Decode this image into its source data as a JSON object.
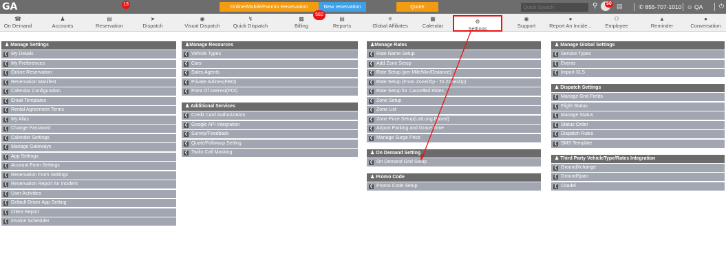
{
  "app": {
    "logo": "GA"
  },
  "topbar": {
    "buttons": [
      {
        "label": "Online/Mobile/Farmin Reservation",
        "color": "#f39c12"
      },
      {
        "label": "New reservation",
        "color": "#3fa0e8"
      },
      {
        "label": "Quote",
        "color": "#f39c12"
      }
    ],
    "search_placeholder": "Quick Search",
    "notifications_count": "50",
    "phone": "855-707-1010",
    "user": "QA"
  },
  "nav": {
    "items": [
      {
        "label": "On Demand",
        "icon": "phone-icon"
      },
      {
        "label": "Accounts",
        "icon": "user-icon"
      },
      {
        "label": "Reservation",
        "icon": "reservation-icon",
        "badge": "13"
      },
      {
        "label": "Dispatch",
        "icon": "send-icon"
      },
      {
        "label": "Visual Dispatch",
        "icon": "eye-icon"
      },
      {
        "label": "Quick Dispatch",
        "icon": "lightning-icon"
      },
      {
        "label": "Billing",
        "icon": "money-icon"
      },
      {
        "label": "Reports",
        "icon": "file-icon"
      },
      {
        "label": "Global Affiliates",
        "icon": "network-icon"
      },
      {
        "label": "Calendar",
        "icon": "calendar-icon"
      },
      {
        "label": "Settings",
        "icon": "gear-icon",
        "active": true
      },
      {
        "label": "Support",
        "icon": "support-icon"
      },
      {
        "label": "Report An Incide...",
        "icon": "alert-icon"
      },
      {
        "label": "Employee",
        "icon": "employee-icon"
      },
      {
        "label": "Reminder",
        "icon": "bell-icon"
      },
      {
        "label": "Conversation",
        "icon": "chat-icon"
      }
    ],
    "dispatch_badge": "582"
  },
  "sections": {
    "manage_settings": {
      "title": "Manage Settings",
      "items": [
        "My Details",
        "My Preferences",
        "Online Reservation",
        "Reservation Manifest",
        "Calendar Configuration",
        "Email Templates",
        "Rental Agreement Terms",
        "My Alias",
        "Change Password",
        "Calender Settings",
        "Manage Gateways",
        "App Settings",
        "Account Form Settings",
        "Reservation Form Settings",
        "Reservation Report An Incident",
        "User Activities",
        "Default Driver App Setting",
        "Client Report",
        "Invoice Scheduler"
      ]
    },
    "manage_resources": {
      "title": "Manage Resources",
      "items": [
        "Vehicle Types",
        "Cars",
        "Sales Agents",
        "Private Airlines(FBO)",
        "Point Of Interest(POI)"
      ]
    },
    "additional_services": {
      "title": "Additional Services",
      "items": [
        "Credit Card Authorization",
        "Google API Integration",
        "Survey/Feedback",
        "Quote/Followup Setting",
        "Twilio Call Masking"
      ]
    },
    "manage_rates": {
      "title": "Manage Rates",
      "items": [
        "Rate Name Setup",
        "Add Zone Setup",
        "Rate Setup (per Mile/Min/Distance)",
        "Rate Setup (From Zone/Zip - To Zone/Zip)",
        "Rate Setup for Cancelled Rides",
        "Zone Setup",
        "Zone List",
        "Zone Price Setup(LatLong Based)",
        "Airport Parking and Grace Time",
        "Manage Surge Price"
      ]
    },
    "on_demand_setting": {
      "title": "On Demand Setting",
      "items": [
        "On Demand Grid Setup"
      ]
    },
    "promo_code": {
      "title": "Promo Code",
      "items": [
        "Promo Code Setup"
      ]
    },
    "manage_global": {
      "title": "Manage Global Settings",
      "items": [
        "Service Types",
        "Events",
        "Import XLS"
      ]
    },
    "dispatch_settings": {
      "title": "Dispatch Settings",
      "items": [
        "Manage Grid Fields",
        "Flight Status",
        "Manage Status",
        "Status Order",
        "Dispatch Rules",
        "SMS Template"
      ]
    },
    "third_party": {
      "title": "Third Party VehicleType/Rates Integration",
      "items": [
        "GroundXchange",
        "GroundSpan",
        "Citadel"
      ]
    }
  }
}
